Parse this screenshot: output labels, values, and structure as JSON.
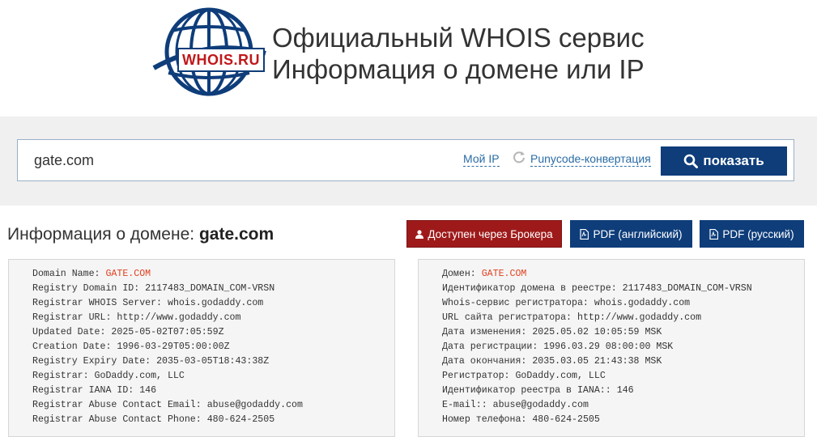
{
  "header": {
    "logo_text": "WHOIS.RU",
    "title_line1": "Официальный WHOIS сервис",
    "title_line2": "Информация о домене или IP"
  },
  "search": {
    "value": "gate.com",
    "my_ip_label": "Мой IP",
    "punycode_label": "Punycode-конвертация",
    "show_label": "показать"
  },
  "domain_info": {
    "heading_prefix": "Информация о домене:",
    "domain": "gate.com",
    "broker_label": "Доступен через Брокера",
    "pdf_en_label": "PDF (английский)",
    "pdf_ru_label": "PDF (русский)"
  },
  "raw_en": [
    {
      "label": "Domain Name: ",
      "value": "GATE.COM",
      "highlight": true
    },
    {
      "label": "Registry Domain ID: ",
      "value": "2117483_DOMAIN_COM-VRSN"
    },
    {
      "label": "Registrar WHOIS Server: ",
      "value": "whois.godaddy.com"
    },
    {
      "label": "Registrar URL: ",
      "value": "http://www.godaddy.com"
    },
    {
      "label": "Updated Date: ",
      "value": "2025-05-02T07:05:59Z"
    },
    {
      "label": "Creation Date: ",
      "value": "1996-03-29T05:00:00Z"
    },
    {
      "label": "Registry Expiry Date: ",
      "value": "2035-03-05T18:43:38Z"
    },
    {
      "label": "Registrar: ",
      "value": "GoDaddy.com, LLC"
    },
    {
      "label": "Registrar IANA ID: ",
      "value": "146"
    },
    {
      "label": "Registrar Abuse Contact Email: ",
      "value": "abuse@godaddy.com"
    },
    {
      "label": "Registrar Abuse Contact Phone: ",
      "value": "480-624-2505"
    }
  ],
  "raw_ru": [
    {
      "label": "Домен: ",
      "value": "GATE.COM",
      "highlight": true
    },
    {
      "label": "Идентификатор домена в реестре: ",
      "value": "2117483_DOMAIN_COM-VRSN"
    },
    {
      "label": "Whois-сервис регистратора: ",
      "value": "whois.godaddy.com"
    },
    {
      "label": "URL сайта регистратора: ",
      "value": "http://www.godaddy.com"
    },
    {
      "label": "Дата изменения: ",
      "value": "2025.05.02 10:05:59 MSK"
    },
    {
      "label": "Дата регистрации: ",
      "value": "1996.03.29 08:00:00 MSK"
    },
    {
      "label": "Дата окончания: ",
      "value": "2035.03.05 21:43:38 MSK"
    },
    {
      "label": "Регистратор: ",
      "value": "GoDaddy.com, LLC"
    },
    {
      "label": "Идентификатор реестра в IANA:: ",
      "value": "146"
    },
    {
      "label": "E-mail:: ",
      "value": "abuse@godaddy.com"
    },
    {
      "label": "Номер телефона: ",
      "value": "480-624-2505"
    }
  ],
  "colors": {
    "brand_blue": "#0e3d7a",
    "broker_red": "#9e1a1a",
    "highlight_orange": "#e0401f",
    "link_blue": "#2a6ca5"
  },
  "icons": {
    "globe": "globe-logo-icon",
    "refresh": "refresh-icon",
    "search": "search-icon",
    "user": "user-icon",
    "pdf": "pdf-file-icon"
  }
}
